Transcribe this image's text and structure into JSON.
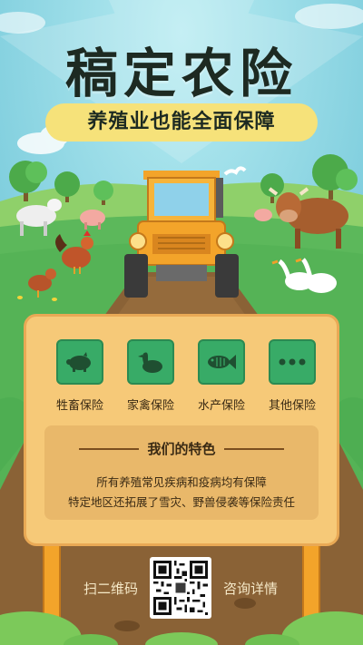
{
  "header": {
    "title": "稿定农险",
    "subtitle": "养殖业也能全面保障"
  },
  "insurance_types": [
    {
      "label": "牲畜保险",
      "icon": "pig-icon"
    },
    {
      "label": "家禽保险",
      "icon": "duck-icon"
    },
    {
      "label": "水产保险",
      "icon": "fish-icon"
    },
    {
      "label": "其他保险",
      "icon": "more-dots-icon"
    }
  ],
  "features": {
    "title": "我们的特色",
    "lines": [
      "所有养殖常见疾病和疫病均有保障",
      "特定地区还拓展了雪灾、野兽侵袭等保险责任"
    ]
  },
  "footer": {
    "scan_label": "扫二维码",
    "consult_label": "咨询详情"
  },
  "colors": {
    "sky": "#6ec5d8",
    "grass": "#5cb85b",
    "board": "#f6c978",
    "tile": "#38ab67",
    "title_bg": "#f6e27a"
  }
}
